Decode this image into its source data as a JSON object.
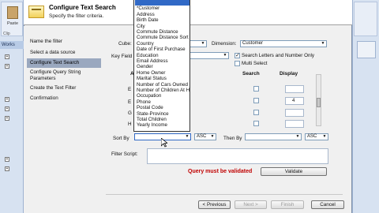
{
  "app": {
    "paste_label": "Paste",
    "clipboard_label": "Clip",
    "works_tab": "Works",
    "tree_icon": "expand-box-icon"
  },
  "header": {
    "title": "Configure Text Search",
    "subtitle": "Specify the filter criteria."
  },
  "nav": {
    "items": [
      {
        "label": "Name the filter",
        "selected": false
      },
      {
        "label": "Select a data source",
        "selected": false
      },
      {
        "label": "Configure Text Search",
        "selected": true
      },
      {
        "label": "Configure Query String Parameters",
        "selected": false
      },
      {
        "label": "Create the Text Filter",
        "selected": false
      },
      {
        "label": "Confirmation",
        "selected": false
      }
    ]
  },
  "form": {
    "cube_label": "Cube:",
    "dimension_label": "Dimension:",
    "dimension_value": "Customer",
    "key_field_label": "Key Field",
    "search_letters_label": "Search Letters and Number Only",
    "search_letters_checked": true,
    "multi_select_label": "Multi Select",
    "multi_select_checked": false,
    "col_attribute_label": "A",
    "col_search_label": "Search",
    "col_display_label": "Display",
    "row_labels": [
      "E",
      "E",
      "G",
      "H"
    ],
    "display_values": [
      "",
      "4",
      "",
      ""
    ],
    "sort_by_label": "Sort By",
    "sort_by_value": "",
    "sort_by_dir": "ASC",
    "then_by_label": "Then By",
    "then_by_value": "",
    "then_by_dir": "ASC",
    "filter_script_label": "Filter Script:",
    "validation_message": "Query must be validated",
    "validate_button": "Validate"
  },
  "dropdown": {
    "items": [
      {
        "label": "",
        "selected": true
      },
      {
        "label": "*Customer",
        "selected": false
      },
      {
        "label": "Address",
        "selected": false
      },
      {
        "label": "Birth Date",
        "selected": false
      },
      {
        "label": "City",
        "selected": false
      },
      {
        "label": "Commute Distance",
        "selected": false
      },
      {
        "label": "Commute Distance Sort",
        "selected": false
      },
      {
        "label": "Country",
        "selected": false
      },
      {
        "label": "Date of First Purchase",
        "selected": false
      },
      {
        "label": "Education",
        "selected": false
      },
      {
        "label": "Email Address",
        "selected": false
      },
      {
        "label": "Gender",
        "selected": false
      },
      {
        "label": "Home Owner",
        "selected": false
      },
      {
        "label": "Marital Status",
        "selected": false
      },
      {
        "label": "Number of Cars Owned",
        "selected": false
      },
      {
        "label": "Number of Children At Home",
        "selected": false
      },
      {
        "label": "Occupation",
        "selected": false
      },
      {
        "label": "Phone",
        "selected": false
      },
      {
        "label": "Postal Code",
        "selected": false
      },
      {
        "label": "State-Province",
        "selected": false
      },
      {
        "label": "Total Children",
        "selected": false
      },
      {
        "label": "Yearly Income",
        "selected": false
      }
    ]
  },
  "footer": {
    "previous": "< Previous",
    "next": "Next >",
    "finish": "Finish",
    "cancel": "Cancel"
  }
}
